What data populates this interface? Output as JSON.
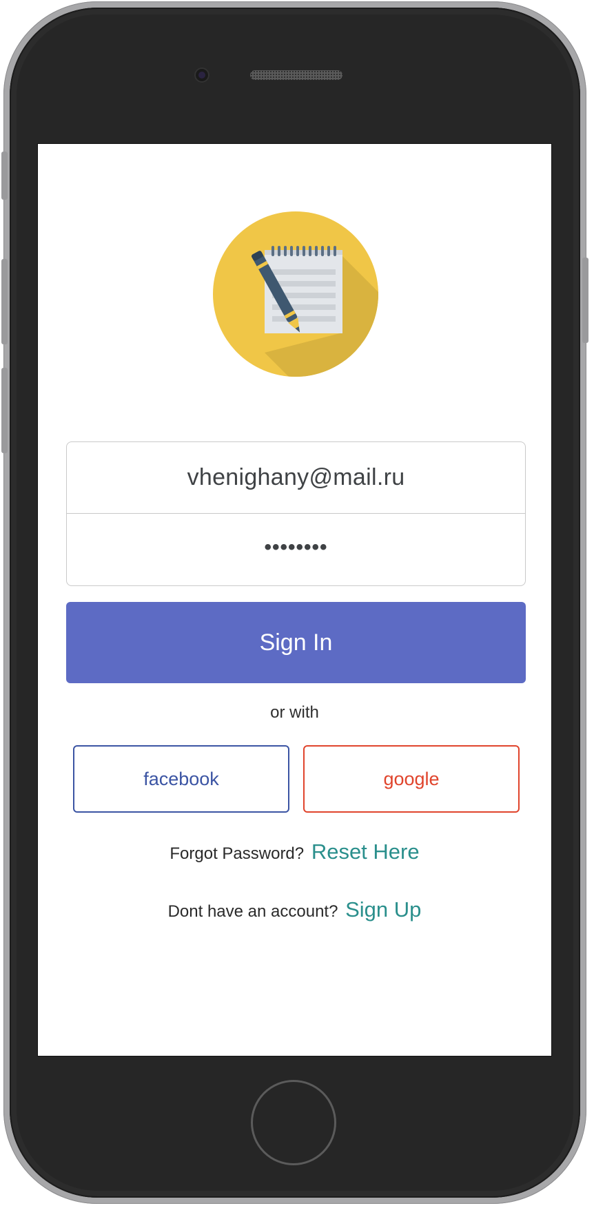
{
  "login": {
    "email_value": "vhenighany@mail.ru",
    "password_value": "••••••••",
    "signin_label": "Sign In",
    "or_with_text": "or with",
    "social": {
      "facebook_label": "facebook",
      "google_label": "google"
    },
    "forgot": {
      "prompt": "Forgot Password?",
      "link": "Reset Here"
    },
    "signup": {
      "prompt": "Dont have an account?",
      "link": "Sign Up"
    }
  },
  "colors": {
    "primary": "#5d6bc4",
    "facebook": "#3b54a3",
    "google": "#e0442c",
    "link": "#2a8f8c",
    "logo_circle": "#f0c647"
  },
  "icons": {
    "logo": "notepad-pencil-icon"
  }
}
